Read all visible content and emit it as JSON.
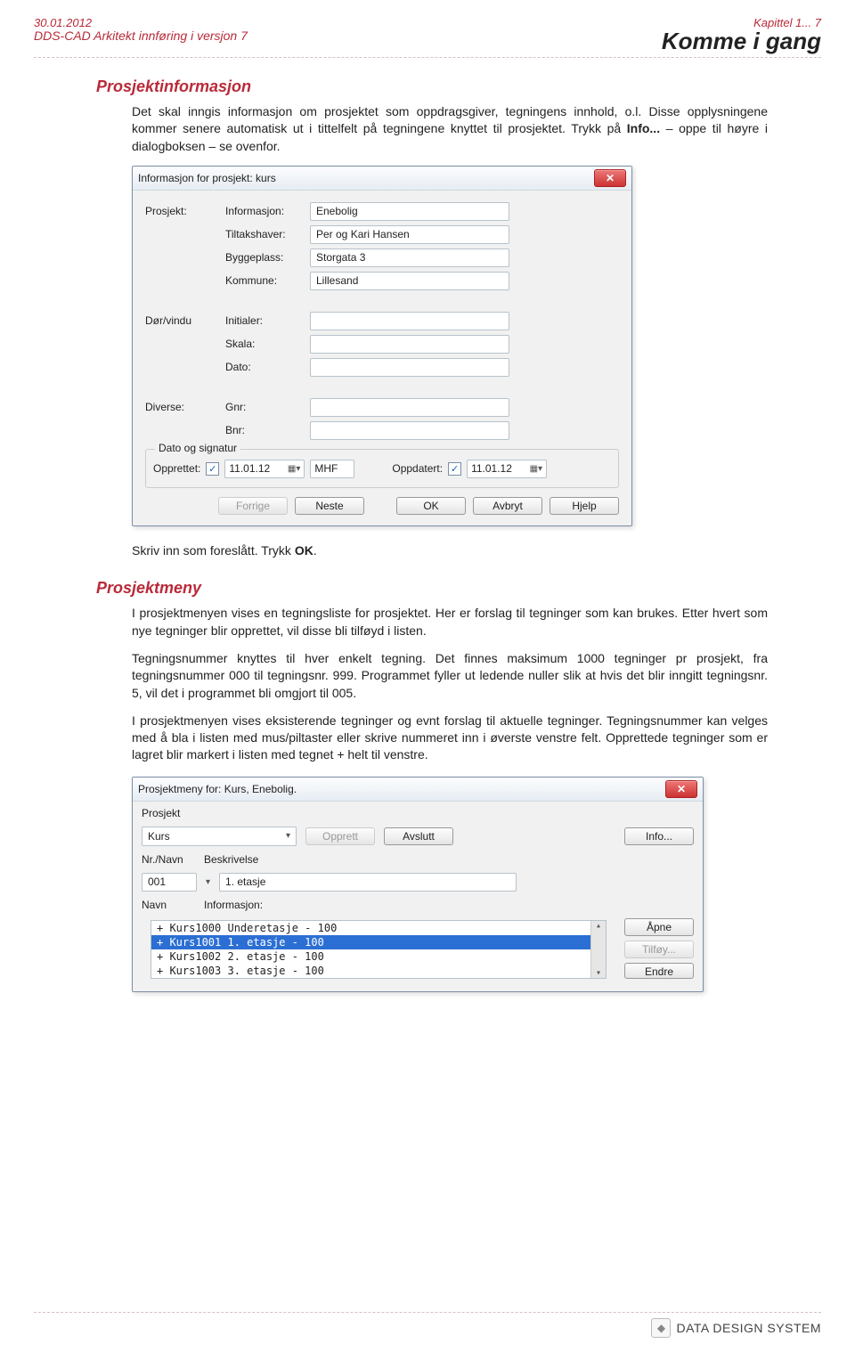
{
  "header": {
    "date": "30.01.2012",
    "product_line": "DDS-CAD Arkitekt  innføring i versjon 7",
    "chapter": "Kapittel 1... 7",
    "main_title": "Komme i gang"
  },
  "sec1": {
    "title": "Prosjektinformasjon",
    "p1": "Det skal inngis informasjon om prosjektet som oppdragsgiver, tegningens innhold, o.l. Disse opplysningene kommer senere automatisk ut i tittelfelt på tegningene knyttet til prosjektet. Trykk på ",
    "p1b": "Info...",
    "p1c": " – oppe til høyre i dialogboksen – se ovenfor."
  },
  "dlg1": {
    "title": "Informasjon for prosjekt:  kurs",
    "rows": {
      "prosjekt": "Prosjekt:",
      "informasjon": "Informasjon:",
      "informasjon_val": "Enebolig",
      "tiltakshaver": "Tiltakshaver:",
      "tiltakshaver_val": "Per og Kari Hansen",
      "byggeplass": "Byggeplass:",
      "byggeplass_val": "Storgata 3",
      "kommune": "Kommune:",
      "kommune_val": "Lillesand",
      "dorvindu": "Dør/vindu",
      "initialer": "Initialer:",
      "skala": "Skala:",
      "dato": "Dato:",
      "diverse": "Diverse:",
      "gnr": "Gnr:",
      "bnr": "Bnr:"
    },
    "date_section": {
      "legend": "Dato og signatur",
      "opprettet": "Opprettet:",
      "oppdatert": "Oppdatert:",
      "date1": "11.01.12",
      "date2": "11.01.12",
      "mhf": "MHF"
    },
    "buttons": {
      "forrige": "Forrige",
      "neste": "Neste",
      "ok": "OK",
      "avbryt": "Avbryt",
      "hjelp": "Hjelp"
    }
  },
  "midtext": {
    "line": "Skriv inn som foreslått. Trykk ",
    "ok": "OK",
    "dot": "."
  },
  "sec2": {
    "title": "Prosjektmeny",
    "p1": "I prosjektmenyen vises en tegningsliste for prosjektet. Her er forslag til tegninger som kan brukes. Etter hvert som nye tegninger blir opprettet, vil disse bli tilføyd i listen.",
    "p2": "Tegningsnummer  knyttes til hver enkelt tegning. Det finnes maksimum 1000 tegninger pr prosjekt, fra tegningsnummer 000 til tegningsnr. 999. Programmet fyller ut ledende nuller slik at hvis det blir inngitt tegningsnr. 5, vil det i programmet bli omgjort til 005.",
    "p3": "I prosjektmenyen vises eksisterende tegninger og evnt forslag til aktuelle tegninger. Tegningsnummer kan velges med å bla i listen med mus/piltaster eller skrive nummeret inn i øverste venstre felt. Opprettede tegninger som er lagret blir markert i listen med tegnet + helt til venstre."
  },
  "dlg2": {
    "title": "Prosjektmeny for: Kurs, Enebolig.",
    "prosjekt_label": "Prosjekt",
    "prosjekt_val": "Kurs",
    "opprett": "Opprett",
    "avslutt": "Avslutt",
    "info": "Info...",
    "nrnavn": "Nr./Navn",
    "beskrivelse": "Beskrivelse",
    "nr_val": "001",
    "besk_val": "1. etasje",
    "navn": "Navn",
    "informasjon": "Informasjon:",
    "list": [
      "+ Kurs1000  Underetasje - 100",
      "+ Kurs1001  1. etasje - 100",
      "+ Kurs1002  2. etasje - 100",
      "+ Kurs1003  3. etasje - 100"
    ],
    "apne": "Åpne",
    "tilfoy": "Tilføy...",
    "endre": "Endre"
  },
  "footer": {
    "brand": "DATA DESIGN SYSTEM"
  }
}
